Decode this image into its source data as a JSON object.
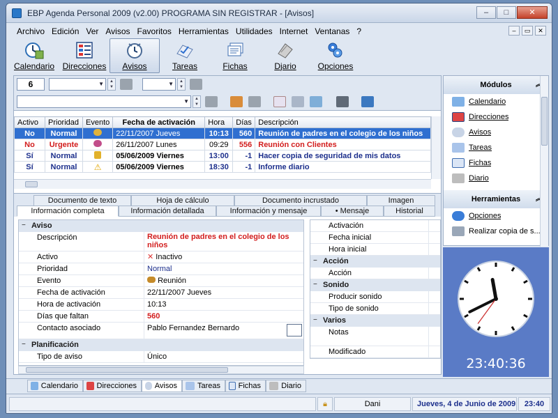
{
  "window": {
    "title": "EBP Agenda Personal 2009 (v2.00) PROGRAMA SIN REGISTRAR - [Avisos]"
  },
  "menu": [
    "Archivo",
    "Edición",
    "Ver",
    "Avisos",
    "Favoritos",
    "Herramientas",
    "Utilidades",
    "Internet",
    "Ventanas",
    "?"
  ],
  "toolbar": [
    {
      "label": "Calendario",
      "icon": "calendar-clock-icon"
    },
    {
      "label": "Direcciones",
      "icon": "address-book-icon"
    },
    {
      "label": "Avisos",
      "icon": "alarm-icon",
      "active": true
    },
    {
      "label": "Tareas",
      "icon": "tasks-icon"
    },
    {
      "label": "Fichas",
      "icon": "cards-icon"
    },
    {
      "label": "Djario",
      "icon": "diary-icon"
    },
    {
      "label": "Opciones",
      "icon": "options-icon"
    }
  ],
  "filter": {
    "number": "6"
  },
  "grid": {
    "columns": [
      "Activo",
      "Prioridad",
      "Evento",
      "Fecha de activación",
      "Hora",
      "Días",
      "Descripción"
    ],
    "rows": [
      {
        "activo": "No",
        "prioridad": "Normal",
        "evento": "meeting-icon",
        "fecha": "22/11/2007 Jueves",
        "hora": "10:13",
        "dias": "560",
        "descripcion": "Reunión de padres en el colegio de los niños",
        "style": "sel"
      },
      {
        "activo": "No",
        "prioridad": "Urgente",
        "evento": "meeting-icon",
        "fecha": "26/11/2007 Lunes",
        "hora": "09:29",
        "dias": "556",
        "descripcion": "Reunión con Clientes",
        "style": "urgent"
      },
      {
        "activo": "Sí",
        "prioridad": "Normal",
        "evento": "lock-icon",
        "fecha": "05/06/2009 Viernes",
        "hora": "13:00",
        "dias": "-1",
        "descripcion": "Hacer copia de seguridad de mis datos",
        "style": "bold"
      },
      {
        "activo": "Sí",
        "prioridad": "Normal",
        "evento": "warning-icon",
        "fecha": "05/06/2009 Viernes",
        "hora": "18:30",
        "dias": "-1",
        "descripcion": "Informe diario",
        "style": "bold"
      }
    ]
  },
  "detailTabs": {
    "top": [
      "Documento de texto",
      "Hoja de cálculo",
      "Documento incrustado",
      "Imagen"
    ],
    "bottom": [
      "Información completa",
      "Información detallada",
      "Información y mensaje",
      "• Mensaje",
      "Historial"
    ]
  },
  "props": {
    "aviso_cat": "Aviso",
    "descripcion_k": "Descripción",
    "descripcion_v": "Reunión de padres en el colegio de los niños",
    "activo_k": "Activo",
    "activo_v": "Inactivo",
    "prioridad_k": "Prioridad",
    "prioridad_v": "Normal",
    "evento_k": "Evento",
    "evento_v": "Reunión",
    "fecha_k": "Fecha de activación",
    "fecha_v": "22/11/2007 Jueves",
    "hora_k": "Hora de activación",
    "hora_v": "10:13",
    "dias_k": "Días que faltan",
    "dias_v": "560",
    "contacto_k": "Contacto asociado",
    "contacto_v": "Pablo Fernandez Bernardo",
    "planif_cat": "Planificación",
    "tipo_k": "Tipo de aviso",
    "tipo_v": "Único"
  },
  "props2": {
    "activacion": "Activación",
    "fecha_inicial": "Fecha inicial",
    "hora_inicial": "Hora inicial",
    "accion_cat": "Acción",
    "accion": "Acción",
    "sonido_cat": "Sonido",
    "producir": "Producir sonido",
    "tipo_sonido": "Tipo de sonido",
    "varios_cat": "Varios",
    "notas": "Notas",
    "modificado": "Modificado"
  },
  "modules": {
    "title": "Módulos",
    "items": [
      "Calendario",
      "Direcciones",
      "Avisos",
      "Tareas",
      "Fichas",
      "Diario"
    ],
    "tools_title": "Herramientas",
    "tools": [
      "Opciones",
      "Realizar copia de s..."
    ]
  },
  "clock": {
    "digital": "23:40:36"
  },
  "bottomTabs": [
    "Calendario",
    "Direcciones",
    "Avisos",
    "Tareas",
    "Fichas",
    "Diario"
  ],
  "status": {
    "user": "Dani",
    "date": "Jueves, 4 de Junio de 2009",
    "time": "23:40"
  },
  "colors": {
    "accent": "#2f6fd0",
    "urgent": "#d21d1d",
    "clockBg": "#5a7bc6"
  }
}
